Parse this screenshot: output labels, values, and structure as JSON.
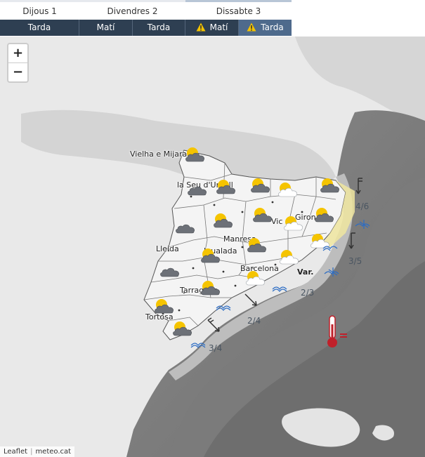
{
  "days": [
    {
      "label": "Dijous 1"
    },
    {
      "label": "Divendres 2"
    },
    {
      "label": "Dissabte 3"
    }
  ],
  "periods": [
    {
      "label": "Tarda",
      "warning": false,
      "selected": false
    },
    {
      "label": "Matí",
      "warning": false,
      "selected": false
    },
    {
      "label": "Tarda",
      "warning": false,
      "selected": false
    },
    {
      "label": "Matí",
      "warning": true,
      "selected": false
    },
    {
      "label": "Tarda",
      "warning": true,
      "selected": true
    }
  ],
  "zoom": {
    "in_label": "+",
    "out_label": "−"
  },
  "attribution": {
    "leaflet": "Leaflet",
    "source": "meteo.cat"
  },
  "cities": {
    "vielha": "Vielha e Mijaran",
    "seu": "la Seu d'Urgell",
    "lleida": "Lleida",
    "manresa": "Manresa",
    "igualada": "Igualada",
    "barcelona": "Barcelona",
    "tarragona": "Tarragona",
    "tortosa": "Tortosa",
    "vic": "Vic",
    "girona": "Girona"
  },
  "sea": {
    "var_label": "Var.",
    "state_1": "4/6",
    "state_2": "3/5",
    "state_3": "2/3",
    "state_4": "2/4",
    "state_5": "3/4"
  },
  "colors": {
    "tab_dark": "#2e3f52",
    "tab_selected": "#4e6a8c",
    "warning_yellow": "#f2c200",
    "sea_dark": "#7f7f7f",
    "land_light": "#ececec"
  }
}
